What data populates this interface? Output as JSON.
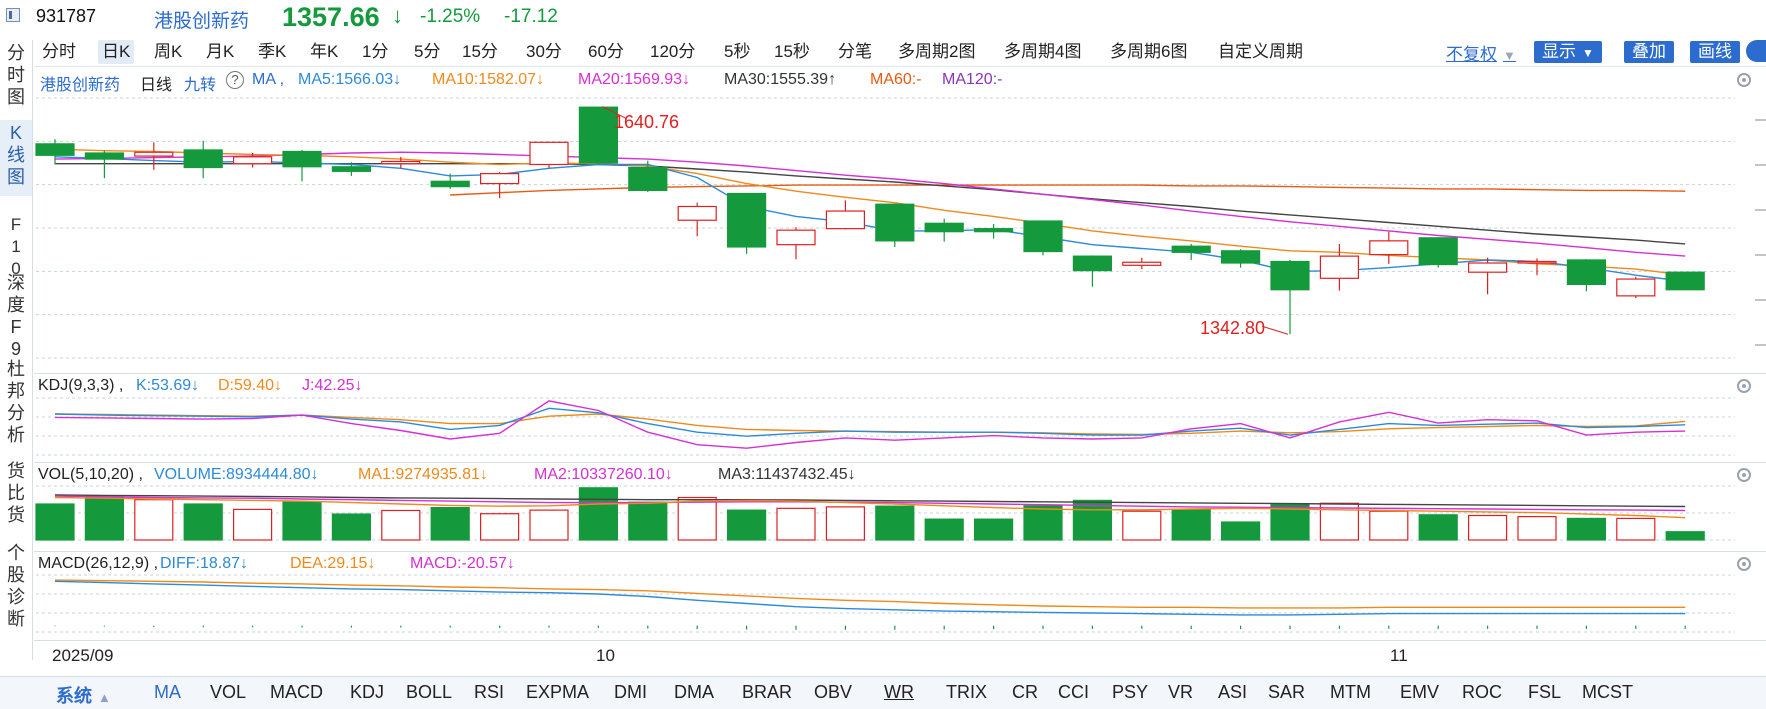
{
  "header": {
    "code": "931787",
    "name": "港股创新药",
    "price": "1357.66",
    "price_arrow": "↓",
    "change_pct": "-1.25%",
    "change_abs": "-17.12",
    "colors": {
      "down": "#149a3c",
      "up": "#e02020",
      "link": "#2c6ccf"
    }
  },
  "left_nav": [
    {
      "label": "分时图",
      "active": false
    },
    {
      "label": "K线图",
      "active": true
    },
    {
      "label": "F10",
      "active": false
    },
    {
      "label": "深度F9",
      "active": false
    },
    {
      "label": "杜邦分析",
      "active": false
    },
    {
      "label": "货比货",
      "active": false
    },
    {
      "label": "个股诊断",
      "active": false
    }
  ],
  "periods": [
    "分时",
    "日K",
    "周K",
    "月K",
    "季K",
    "年K",
    "1分",
    "5分",
    "15分",
    "30分",
    "60分",
    "120分",
    "5秒",
    "15秒",
    "分笔",
    "多周期2图",
    "多周期4图",
    "多周期6图",
    "自定义周期"
  ],
  "period_active": "日K",
  "toolbar": {
    "fuquan": "不复权",
    "display": "显示",
    "overlay": "叠加",
    "draw": "画线"
  },
  "main_legend": {
    "name": "港股创新药",
    "period": "日线",
    "jiuzhuan": "九转",
    "help": "?",
    "ma": "MA ,",
    "ma5": "MA5:1566.03↓",
    "ma10": "MA10:1582.07↓",
    "ma20": "MA20:1569.93↓",
    "ma30": "MA30:1555.39↑",
    "ma60": "MA60:-",
    "ma120": "MA120:-"
  },
  "annotations": {
    "high": "1640.76",
    "low": "1342.80"
  },
  "kdj_legend": {
    "title": "KDJ(9,3,3) ,",
    "k": "K:53.69↓",
    "d": "D:59.40↓",
    "j": "J:42.25↓"
  },
  "vol_legend": {
    "title": "VOL(5,10,20) ,",
    "volume": "VOLUME:8934444.80↓",
    "ma1": "MA1:9274935.81↓",
    "ma2": "MA2:10337260.10↓",
    "ma3": "MA3:11437432.45↓"
  },
  "macd_legend": {
    "title": "MACD(26,12,9) ,",
    "diff": "DIFF:18.87↓",
    "dea": "DEA:29.15↓",
    "macd": "MACD:-20.57↓"
  },
  "x_axis": [
    "2025/09",
    "10",
    "11"
  ],
  "indicators": [
    "系统",
    "MA",
    "VOL",
    "MACD",
    "KDJ",
    "BOLL",
    "RSI",
    "EXPMA",
    "DMI",
    "DMA",
    "BRAR",
    "OBV",
    "WR",
    "TRIX",
    "CR",
    "CCI",
    "PSY",
    "VR",
    "ASI",
    "SAR",
    "MTM",
    "EMV",
    "ROC",
    "FSL",
    "MCST"
  ],
  "chart_data": {
    "type": "candlestick",
    "ohlc": [
      {
        "o": 1592,
        "h": 1598,
        "l": 1565,
        "c": 1577
      },
      {
        "o": 1580,
        "h": 1583,
        "l": 1547,
        "c": 1572
      },
      {
        "o": 1576,
        "h": 1594,
        "l": 1558,
        "c": 1581
      },
      {
        "o": 1584,
        "h": 1596,
        "l": 1547,
        "c": 1561
      },
      {
        "o": 1566,
        "h": 1580,
        "l": 1561,
        "c": 1575
      },
      {
        "o": 1582,
        "h": 1584,
        "l": 1543,
        "c": 1562
      },
      {
        "o": 1562,
        "h": 1568,
        "l": 1550,
        "c": 1556
      },
      {
        "o": 1566,
        "h": 1575,
        "l": 1560,
        "c": 1569
      },
      {
        "o": 1543,
        "h": 1553,
        "l": 1533,
        "c": 1536
      },
      {
        "o": 1540,
        "h": 1555,
        "l": 1521,
        "c": 1553
      },
      {
        "o": 1565,
        "h": 1575,
        "l": 1560,
        "c": 1594
      },
      {
        "o": 1640,
        "h": 1640.76,
        "l": 1565,
        "c": 1567
      },
      {
        "o": 1561,
        "h": 1570,
        "l": 1529,
        "c": 1531
      },
      {
        "o": 1492,
        "h": 1515,
        "l": 1471,
        "c": 1510
      },
      {
        "o": 1527,
        "h": 1527,
        "l": 1448,
        "c": 1457
      },
      {
        "o": 1460,
        "h": 1483,
        "l": 1441,
        "c": 1479
      },
      {
        "o": 1481,
        "h": 1518,
        "l": 1480,
        "c": 1504
      },
      {
        "o": 1513,
        "h": 1513,
        "l": 1457,
        "c": 1465
      },
      {
        "o": 1488,
        "h": 1494,
        "l": 1464,
        "c": 1477
      },
      {
        "o": 1481,
        "h": 1487,
        "l": 1468,
        "c": 1477
      },
      {
        "o": 1491,
        "h": 1491,
        "l": 1446,
        "c": 1451
      },
      {
        "o": 1445,
        "h": 1446,
        "l": 1405,
        "c": 1426
      },
      {
        "o": 1433,
        "h": 1443,
        "l": 1428,
        "c": 1437
      },
      {
        "o": 1458,
        "h": 1461,
        "l": 1440,
        "c": 1450
      },
      {
        "o": 1452,
        "h": 1454,
        "l": 1430,
        "c": 1436
      },
      {
        "o": 1438,
        "h": 1440,
        "l": 1342.8,
        "c": 1401
      },
      {
        "o": 1416,
        "h": 1461,
        "l": 1400,
        "c": 1445
      },
      {
        "o": 1447,
        "h": 1477,
        "l": 1435,
        "c": 1465
      },
      {
        "o": 1469,
        "h": 1469,
        "l": 1430,
        "c": 1434
      },
      {
        "o": 1424,
        "h": 1443,
        "l": 1395,
        "c": 1436
      },
      {
        "o": 1437,
        "h": 1442,
        "l": 1420,
        "c": 1438
      },
      {
        "o": 1440,
        "h": 1441,
        "l": 1399,
        "c": 1408
      },
      {
        "o": 1393,
        "h": 1418,
        "l": 1390,
        "c": 1415
      },
      {
        "o": 1424,
        "h": 1424,
        "l": 1401,
        "c": 1401
      }
    ],
    "ma5": [
      1575,
      1573,
      1570,
      1568,
      1569,
      1567,
      1565,
      1560,
      1550,
      1552,
      1560,
      1565,
      1565,
      1548,
      1510,
      1497,
      1490,
      1478,
      1478,
      1480,
      1470,
      1460,
      1455,
      1450,
      1440,
      1425,
      1426,
      1430,
      1435,
      1440,
      1438,
      1430,
      1420,
      1412
    ],
    "ma10": [
      1585,
      1583,
      1582,
      1580,
      1578,
      1577,
      1575,
      1572,
      1568,
      1565,
      1567,
      1566,
      1563,
      1553,
      1540,
      1530,
      1522,
      1515,
      1505,
      1497,
      1488,
      1478,
      1471,
      1465,
      1458,
      1452,
      1450,
      1446,
      1443,
      1440,
      1435,
      1432,
      1428,
      1420
    ],
    "ma20": [
      1572,
      1573,
      1574,
      1575,
      1576,
      1578,
      1580,
      1581,
      1580,
      1578,
      1576,
      1574,
      1572,
      1568,
      1563,
      1557,
      1551,
      1546,
      1540,
      1533,
      1526,
      1519,
      1512,
      1504,
      1497,
      1490,
      1484,
      1478,
      1472,
      1467,
      1462,
      1456,
      1450,
      1445
    ],
    "ma30": [
      1566,
      1566,
      1566,
      1566,
      1566,
      1566,
      1566,
      1566,
      1566,
      1566,
      1566,
      1565,
      1563,
      1559,
      1555,
      1550,
      1546,
      1542,
      1537,
      1532,
      1526,
      1520,
      1515,
      1510,
      1504,
      1499,
      1494,
      1489,
      1484,
      1479,
      1474,
      1470,
      1466,
      1461
    ],
    "ma60": [
      null,
      null,
      null,
      null,
      null,
      null,
      null,
      null,
      1525,
      1528,
      1531,
      1533,
      1535,
      1536,
      1537,
      1538,
      1538,
      1538,
      1538,
      1538,
      1538,
      1538,
      1538,
      1537,
      1537,
      1536,
      1535,
      1534,
      1533,
      1533,
      1532,
      1531,
      1531,
      1530
    ],
    "kdj_k": [
      72,
      70,
      69,
      68,
      67,
      70,
      63,
      58,
      45,
      52,
      82,
      74,
      55,
      40,
      33,
      38,
      42,
      40,
      40,
      40,
      38,
      35,
      35,
      42,
      47,
      35,
      45,
      55,
      52,
      54,
      56,
      48,
      50,
      53
    ],
    "kdj_d": [
      72,
      71,
      70,
      69,
      68,
      70,
      66,
      62,
      55,
      55,
      68,
      72,
      63,
      52,
      45,
      43,
      42,
      41,
      40,
      40,
      39,
      37,
      36,
      38,
      42,
      39,
      41,
      46,
      48,
      50,
      52,
      50,
      51,
      59
    ],
    "kdj_j": [
      66,
      65,
      64,
      63,
      64,
      70,
      55,
      43,
      28,
      38,
      95,
      78,
      40,
      18,
      12,
      22,
      30,
      26,
      30,
      34,
      30,
      28,
      30,
      46,
      55,
      30,
      58,
      75,
      56,
      62,
      60,
      35,
      40,
      42
    ],
    "vol_up": [
      false,
      false,
      true,
      false,
      true,
      false,
      false,
      true,
      false,
      true,
      true,
      false,
      false,
      true,
      false,
      true,
      true,
      false,
      false,
      false,
      false,
      false,
      true,
      false,
      false,
      false,
      true,
      true,
      false,
      true,
      true,
      false,
      true,
      false
    ],
    "volume": [
      100,
      120,
      112,
      100,
      85,
      105,
      72,
      82,
      90,
      73,
      83,
      145,
      105,
      118,
      83,
      88,
      92,
      94,
      58,
      58,
      95,
      110,
      80,
      85,
      50,
      100,
      102,
      80,
      70,
      68,
      65,
      60,
      60,
      23
    ],
    "vol_ma1": [
      118,
      116,
      114,
      112,
      110,
      108,
      104,
      100,
      96,
      94,
      95,
      100,
      102,
      108,
      110,
      108,
      104,
      100,
      95,
      90,
      86,
      84,
      84,
      86,
      88,
      86,
      84,
      82,
      80,
      78,
      76,
      72,
      68,
      62
    ],
    "vol_ma2": [
      122,
      120,
      118,
      117,
      116,
      114,
      112,
      110,
      108,
      106,
      104,
      104,
      104,
      105,
      106,
      106,
      105,
      104,
      102,
      100,
      98,
      96,
      94,
      92,
      91,
      90,
      89,
      88,
      87,
      86,
      85,
      84,
      83,
      82
    ],
    "vol_ma3": [
      125,
      124,
      123,
      122,
      121,
      120,
      118,
      117,
      116,
      115,
      114,
      113,
      112,
      112,
      112,
      111,
      110,
      109,
      108,
      107,
      106,
      105,
      104,
      103,
      102,
      101,
      100,
      99,
      98,
      97,
      96,
      95,
      94,
      93
    ],
    "macd_diff": [
      70,
      68,
      66,
      64,
      62,
      60,
      58,
      57,
      55,
      53,
      52,
      50,
      46,
      40,
      35,
      30,
      27,
      25,
      23,
      22,
      21,
      20,
      19,
      18,
      17,
      17,
      18,
      19,
      19,
      19,
      19,
      19,
      19,
      19
    ],
    "macd_dea": [
      72,
      71,
      70,
      69,
      67,
      66,
      64,
      63,
      61,
      60,
      58,
      57,
      55,
      51,
      47,
      43,
      40,
      38,
      35,
      33,
      31,
      30,
      29,
      29,
      28,
      28,
      28,
      29,
      29,
      29,
      29,
      29,
      29,
      29
    ],
    "macd_hist": [
      -4,
      -6,
      -8,
      -10,
      -10,
      -12,
      -12,
      -12,
      -12,
      -14,
      -12,
      -14,
      -18,
      -22,
      -24,
      -26,
      -26,
      -26,
      -24,
      -22,
      -20,
      -20,
      -20,
      -22,
      -22,
      -22,
      -20,
      -20,
      -20,
      -20,
      -20,
      -20,
      -20,
      -20
    ]
  }
}
